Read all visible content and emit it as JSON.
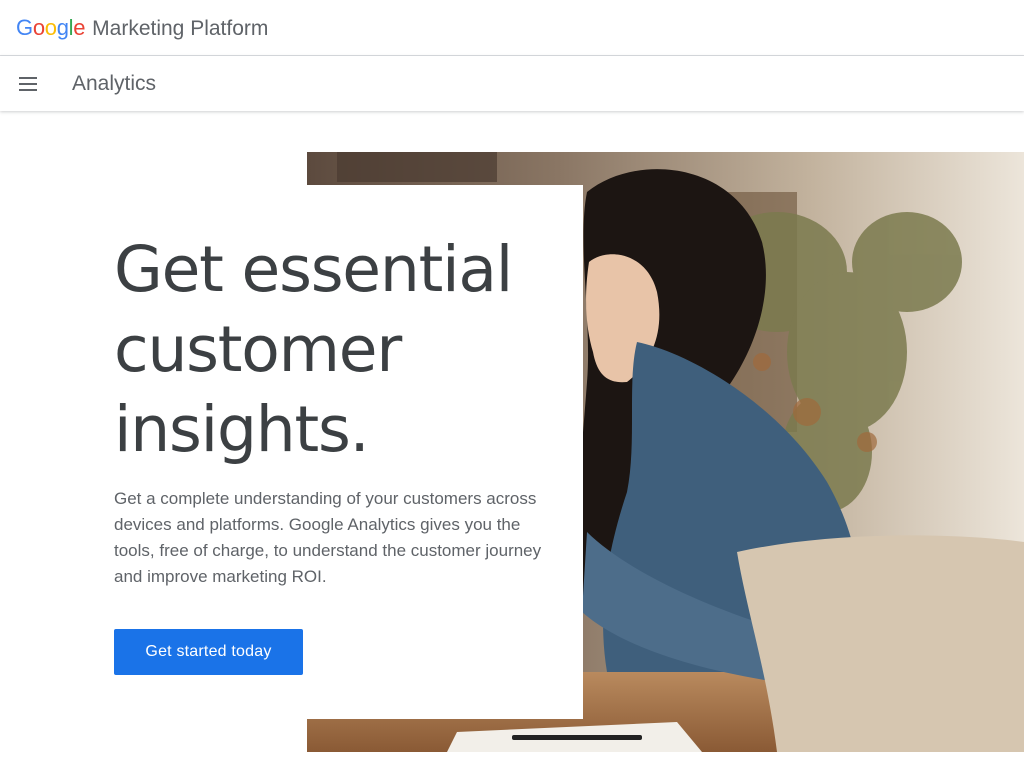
{
  "header": {
    "logo_letters": [
      {
        "char": "G",
        "color": "#4285F4"
      },
      {
        "char": "o",
        "color": "#EA4335"
      },
      {
        "char": "o",
        "color": "#FBBC05"
      },
      {
        "char": "g",
        "color": "#4285F4"
      },
      {
        "char": "l",
        "color": "#34A853"
      },
      {
        "char": "e",
        "color": "#EA4335"
      }
    ],
    "brand_text": "Marketing Platform"
  },
  "subheader": {
    "menu_icon": "hamburger-menu-icon",
    "product_title": "Analytics"
  },
  "hero": {
    "headline_lines": [
      "Get essential",
      "customer",
      "insights."
    ],
    "description": "Get a complete understanding of your customers across devices and platforms. Google Analytics gives you the tools, free of charge, to understand the customer journey and improve marketing ROI.",
    "cta_label": "Get started today",
    "image_subject": "woman in denim shirt and apron leaning on a counter"
  },
  "colors": {
    "accent": "#1a73e8",
    "text_primary": "#3c4043",
    "text_secondary": "#5f6368"
  }
}
